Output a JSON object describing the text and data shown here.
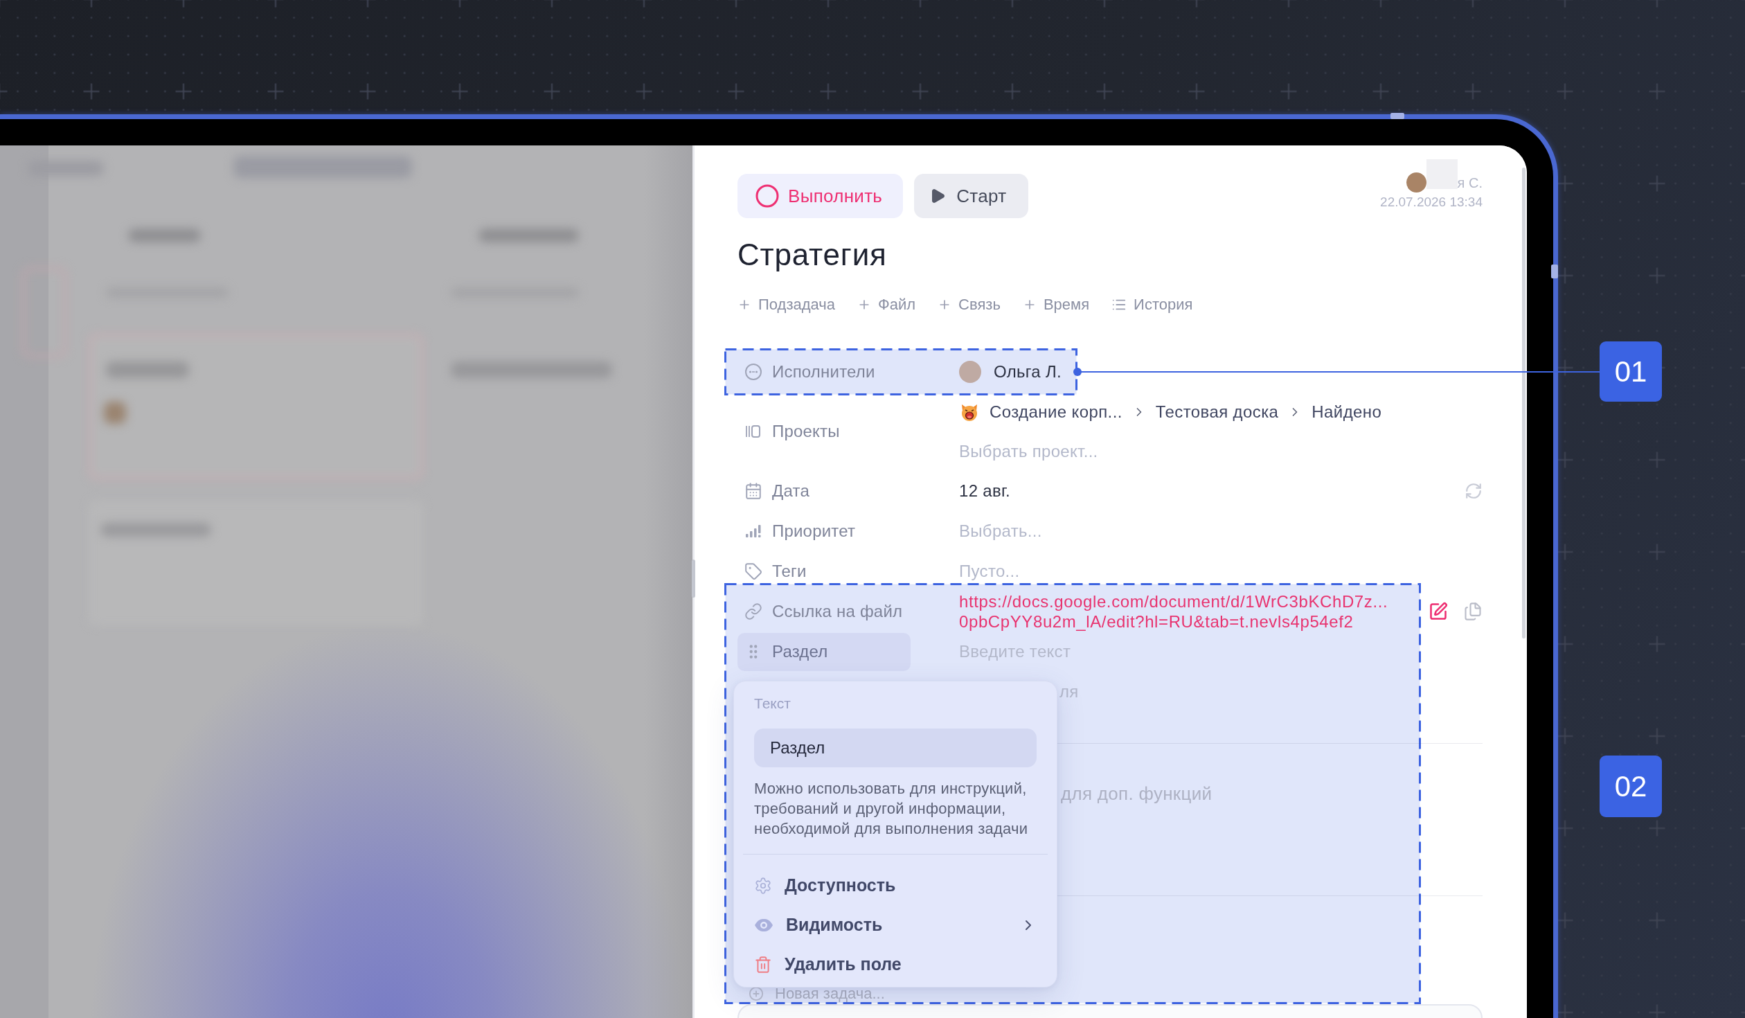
{
  "task_panel": {
    "buttons": [
      {
        "kind": "complete",
        "label": "Выполнить"
      },
      {
        "kind": "start",
        "label": "Старт"
      }
    ],
    "author": {
      "name": "я С.",
      "timestamp": "22.07.2026 13:34"
    },
    "title": "Стратегия",
    "actions": [
      {
        "kind": "add",
        "label": "Подзадача"
      },
      {
        "kind": "add",
        "label": "Файл"
      },
      {
        "kind": "add",
        "label": "Связь"
      },
      {
        "kind": "add",
        "label": "Время"
      },
      {
        "kind": "history",
        "label": "История"
      }
    ],
    "fields": [
      {
        "kind": "assignees",
        "label": "Исполнители",
        "value": "Ольга Л.",
        "selected": false
      },
      {
        "kind": "projects",
        "label": "Проекты",
        "breadcrumbs": [
          "Создание корп...",
          "Тестовая доска",
          "Найдено"
        ],
        "placeholder": "Выбрать проект...",
        "selected": false
      },
      {
        "kind": "date",
        "label": "Дата",
        "value": "12 авг.",
        "selected": false
      },
      {
        "kind": "priority",
        "label": "Приоритет",
        "placeholder": "Выбрать...",
        "selected": false
      },
      {
        "kind": "tags",
        "label": "Теги",
        "placeholder": "Пусто...",
        "selected": false
      },
      {
        "kind": "link",
        "label": "Ссылка на файл",
        "value_lines": [
          "https://docs.google.com/document/d/1WrC3bKChD7z...",
          "0pbCpYY8u2m_lA/edit?hl=RU&tab=t.nevls4p54ef2"
        ],
        "selected": false
      },
      {
        "kind": "section",
        "label": "Раздел",
        "placeholder": "Введите текст",
        "selected": true
      }
    ],
    "partly_covered_row": {
      "value": "ля"
    },
    "description_field": {
      "placeholder": "для доп. функций"
    },
    "new_task_button": {
      "label": "Новая задача..."
    }
  },
  "field_menu": {
    "type_label": "Текст",
    "name_field": {
      "value": "Раздел"
    },
    "hint": "Можно использовать для инструкций, требований и другой информации, необходимой для выполнения задачи",
    "items": [
      {
        "kind": "settings",
        "label": "Доступность",
        "submenu": false
      },
      {
        "kind": "visibility",
        "label": "Видимость",
        "submenu": true
      },
      {
        "kind": "delete",
        "label": "Удалить поле",
        "submenu": false
      }
    ]
  },
  "callouts": [
    {
      "label": "01"
    },
    {
      "label": "02"
    }
  ]
}
